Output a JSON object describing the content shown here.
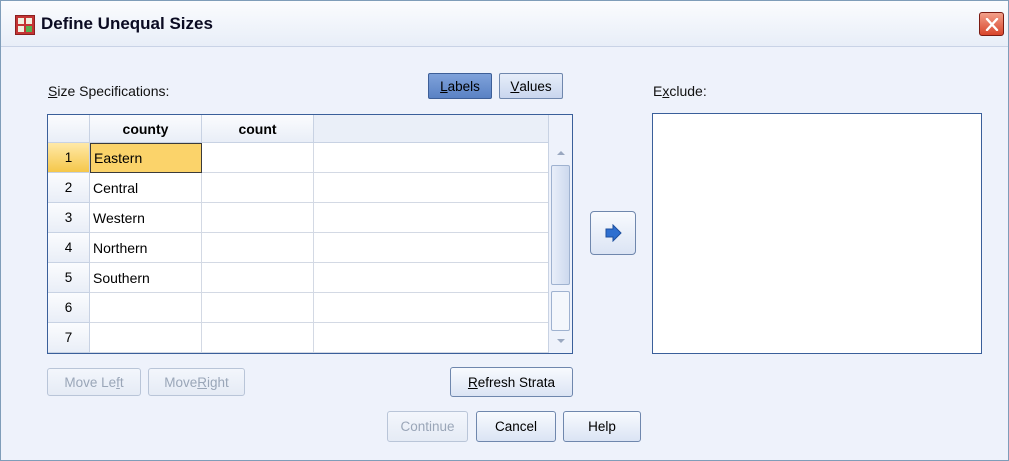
{
  "window": {
    "title": "Define Unequal Sizes",
    "icon": "spss-table-icon",
    "close_icon": "close-icon"
  },
  "size_specs": {
    "label": "Size Specifications:",
    "label_key": "S",
    "label_rest": "ize Specifications:",
    "toggles": {
      "labels": {
        "key": "L",
        "rest": "abels",
        "active": true
      },
      "values": {
        "key": "V",
        "rest": "alues",
        "active": false
      }
    },
    "columns": [
      "county",
      "count"
    ],
    "rows": [
      {
        "num": "1",
        "county": "Eastern",
        "count": ""
      },
      {
        "num": "2",
        "county": "Central",
        "count": ""
      },
      {
        "num": "3",
        "county": "Western",
        "count": ""
      },
      {
        "num": "4",
        "county": "Northern",
        "count": ""
      },
      {
        "num": "5",
        "county": "Southern",
        "count": ""
      },
      {
        "num": "6",
        "county": "",
        "count": ""
      },
      {
        "num": "7",
        "county": "",
        "count": ""
      }
    ],
    "move_left": {
      "pre": "Move Le",
      "key": "f",
      "post": "t"
    },
    "move_right": {
      "pre": "Move ",
      "key": "R",
      "post": "ight"
    },
    "refresh": {
      "pre": "",
      "key": "R",
      "post": "efresh Strata"
    }
  },
  "exclude": {
    "pre": "E",
    "key": "x",
    "post": "clude:"
  },
  "move_arrow_icon": "arrow-right-icon",
  "footer": {
    "continue": "Continue",
    "cancel": "Cancel",
    "help": "Help"
  },
  "colors": {
    "active_cell": "#fbd36a",
    "toggle_active": "#6f93d0",
    "close": "#d8452c",
    "arrow": "#2e6fd0"
  }
}
